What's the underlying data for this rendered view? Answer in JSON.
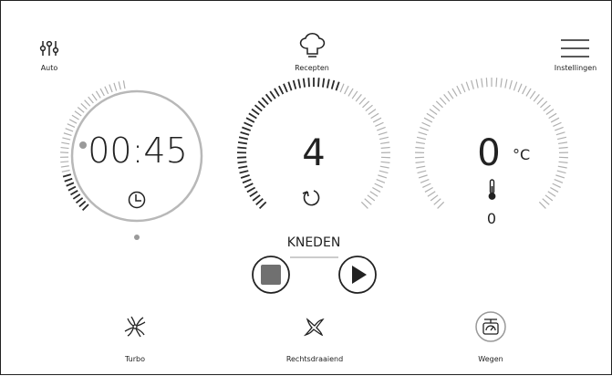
{
  "top_bar": {
    "auto_label": "Auto",
    "recipes_label": "Recepten",
    "settings_label": "Instellingen"
  },
  "timer": {
    "value": "00:45",
    "icon": "clock-icon"
  },
  "speed": {
    "value": "4",
    "mode_label": "KNEDEN",
    "icon": "rotate-icon"
  },
  "temperature": {
    "value": "0",
    "unit": "°C",
    "sub_value": "0",
    "icon": "thermometer-icon"
  },
  "controls": {
    "stop_icon": "stop-icon",
    "play_icon": "play-icon"
  },
  "bottom_bar": {
    "turbo_label": "Turbo",
    "direction_label": "Rechtsdraaiend",
    "weigh_label": "Wegen"
  },
  "colors": {
    "ink": "#222222",
    "ring": "#b8b8b8",
    "stop_fill": "#707070"
  }
}
